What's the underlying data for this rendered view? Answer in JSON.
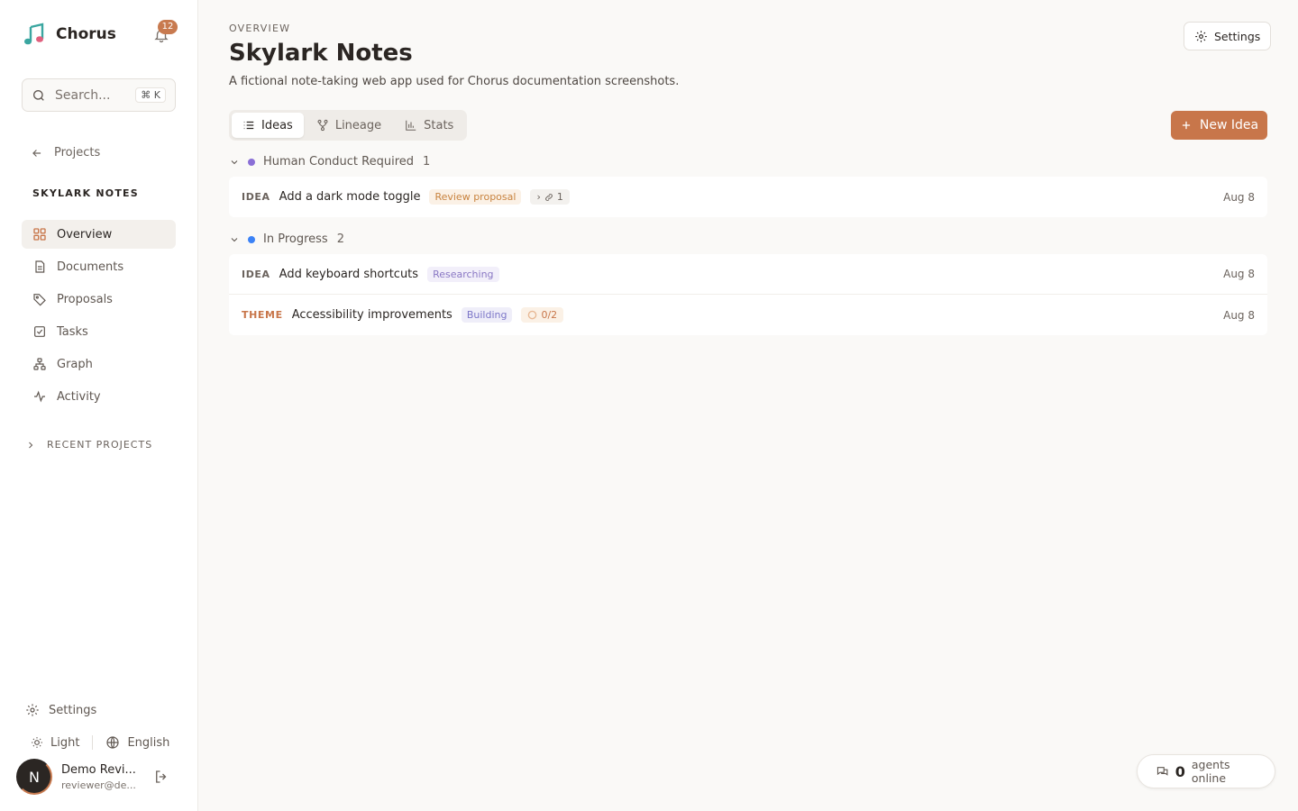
{
  "app": {
    "name": "Chorus",
    "notifications": "12",
    "search_placeholder": "Search...",
    "search_shortcut": "⌘ K"
  },
  "sidebar": {
    "back_label": "Projects",
    "project_label": "SKYLARK NOTES",
    "items": [
      {
        "label": "Overview",
        "icon": "grid-icon"
      },
      {
        "label": "Documents",
        "icon": "document-icon"
      },
      {
        "label": "Proposals",
        "icon": "tag-icon"
      },
      {
        "label": "Tasks",
        "icon": "checkbox-icon"
      },
      {
        "label": "Graph",
        "icon": "graph-icon"
      },
      {
        "label": "Activity",
        "icon": "activity-icon"
      }
    ],
    "recent_label": "RECENT PROJECTS",
    "settings_label": "Settings",
    "theme_label": "Light",
    "language_label": "English",
    "user": {
      "initial": "N",
      "name": "Demo Revi...",
      "email": "reviewer@de..."
    }
  },
  "page": {
    "eyebrow": "OVERVIEW",
    "title": "Skylark Notes",
    "description": "A fictional note-taking web app used for Chorus documentation screenshots.",
    "settings_label": "Settings",
    "new_button": "New Idea",
    "tabs": [
      "Ideas",
      "Lineage",
      "Stats"
    ]
  },
  "groups": [
    {
      "name": "Human Conduct Required",
      "count": "1",
      "color": "#8A6FD6",
      "rows": [
        {
          "kind": "IDEA",
          "title": "Add a dark mode toggle",
          "badge": "Review proposal",
          "chip": "1",
          "date": "Aug 8"
        }
      ]
    },
    {
      "name": "In Progress",
      "count": "2",
      "color": "#3B82F6",
      "rows": [
        {
          "kind": "IDEA",
          "title": "Add keyboard shortcuts",
          "badge": "Researching",
          "date": "Aug 8"
        },
        {
          "kind": "THEME",
          "title": "Accessibility improvements",
          "badge": "Building",
          "chip": "0/2",
          "date": "Aug 8"
        }
      ]
    }
  ],
  "agents": {
    "count": "0",
    "label": "agents online"
  },
  "colors": {
    "accent": "#C8764A",
    "sidebar_bg": "#FFFFFF",
    "main_bg": "#FAF9F7"
  }
}
